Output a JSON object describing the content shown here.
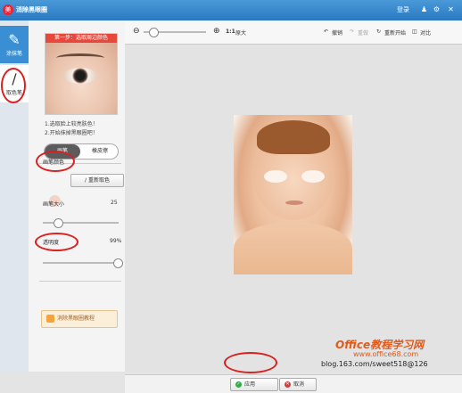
{
  "app": {
    "title": "消除黑眼圈",
    "login": "登录"
  },
  "left_tabs": [
    {
      "label": "涂抹笔"
    },
    {
      "label": "取色笔"
    }
  ],
  "panel": {
    "step_banner": "第一步：选取周边颜色",
    "hint1": "1.选取脸上较亮肤色！",
    "hint2": "2.开始抹掉黑眼圈吧！",
    "modes": [
      "画笔",
      "橡皮擦"
    ],
    "brush_color_label": "画笔颜色",
    "swatch_color": "#f6d3c0",
    "repick_button": "重新取色",
    "brush_size_label": "画笔大小",
    "brush_size_value": "25",
    "brush_size_level": 0.2,
    "opacity_label": "透明度",
    "opacity_value": "99%",
    "opacity_level": 0.99,
    "tutorial_button": "消除黑眼圈教程"
  },
  "toolbar": {
    "zoom_ratio": "1:1",
    "original_size": "原大",
    "undo": "撤销",
    "redo": "重做",
    "restart": "重新开始",
    "compare": "对比",
    "zoom_level": 0.15
  },
  "footer": {
    "apply": "应用",
    "cancel": "取消"
  },
  "watermark": {
    "brand": "Office教程学习网",
    "url": "www.office68.com",
    "blog": "blog.163.com/sweet518@126"
  },
  "colors": {
    "title_bar": "#2a78c2",
    "accent_red": "#d7201f",
    "active_tab": "#3a8fd4"
  }
}
